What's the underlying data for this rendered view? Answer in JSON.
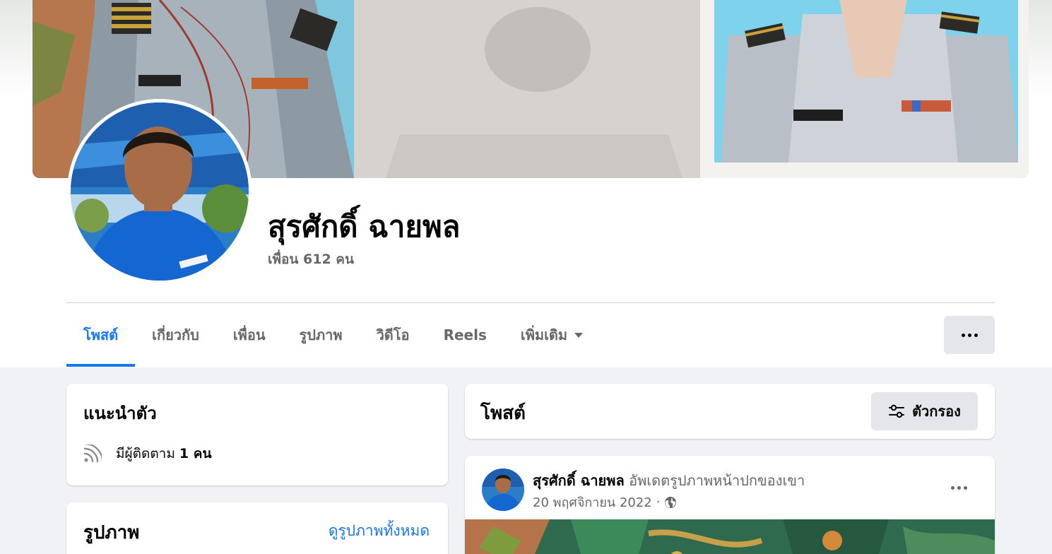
{
  "profile": {
    "name": "สุรศักดิ์ ฉายพล",
    "friends": "เพื่อน 612 คน"
  },
  "tabs": [
    {
      "label": "โพสต์",
      "active": true
    },
    {
      "label": "เกี่ยวกับ",
      "active": false
    },
    {
      "label": "เพื่อน",
      "active": false
    },
    {
      "label": "รูปภาพ",
      "active": false
    },
    {
      "label": "วิดีโอ",
      "active": false
    },
    {
      "label": "Reels",
      "active": false
    },
    {
      "label": "เพิ่มเติม",
      "active": false,
      "icon": "caret-down-icon"
    }
  ],
  "intro": {
    "title": "แนะนำตัว",
    "followers_prefix": "มีผู้ติดตาม",
    "followers_count": "1 คน",
    "icon": "followers-feed-icon"
  },
  "photos": {
    "title": "รูปภาพ",
    "see_all": "ดูรูปภาพทั้งหมด"
  },
  "posts": {
    "title": "โพสต์",
    "filter_label": "ตัวกรอง",
    "filter_icon": "filter-sliders-icon"
  },
  "post": {
    "author": "สุรศักดิ์ ฉายพล",
    "action": "อัพเดตรูปภาพหน้าปกของเขา",
    "date": "20 พฤศจิกายน 2022",
    "separator": "·",
    "privacy_icon": "globe-icon"
  },
  "colors": {
    "accent": "#1877f2",
    "secondary_text": "#65676b",
    "page_background": "#f0f2f5",
    "button_background": "#e4e6eb"
  }
}
